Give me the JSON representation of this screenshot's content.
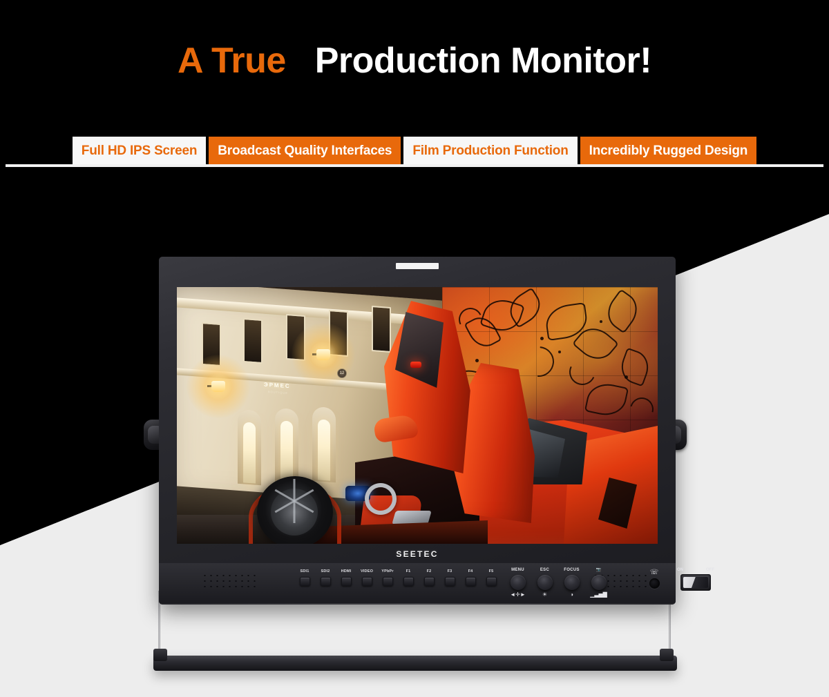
{
  "headline": {
    "accent_text": "A True",
    "plain_text": "Production Monitor!"
  },
  "feature_tabs": [
    {
      "label": "Full HD IPS Screen",
      "style": "light"
    },
    {
      "label": "Broadcast Quality Interfaces",
      "style": "solid"
    },
    {
      "label": "Film Production Function",
      "style": "light"
    },
    {
      "label": "Incredibly Rugged Design",
      "style": "solid"
    }
  ],
  "monitor": {
    "brand": "SEETEC",
    "sensor_strip": "",
    "input_buttons": [
      "SDI1",
      "SDI2",
      "HDMI",
      "VIDEO",
      "YPbPr",
      "F1",
      "F2",
      "F3",
      "F4",
      "F5"
    ],
    "knobs": [
      {
        "label": "MENU",
        "glyph": "◄✛►"
      },
      {
        "label": "ESC",
        "glyph": "☀"
      },
      {
        "label": "FOCUS",
        "glyph": "◑"
      },
      {
        "label": "📷",
        "glyph": "▁▃▅▇"
      }
    ],
    "headphone_jack": {
      "icon": "☏",
      "label": "headphone-jack"
    },
    "power_switch": {
      "on_label": "ON",
      "off_label": "OFF"
    }
  },
  "screen_image": {
    "description": "Orange Lamborghini Aventador with scissor door open at night",
    "building_sign": "ЭРМЕС",
    "building_sign_sub": "BOUTIQUE",
    "house_number": "12"
  },
  "colors": {
    "brand_orange": "#E8690B",
    "background_black": "#000000",
    "background_light": "#EDEDED",
    "tab_light_bg": "#F7F7F7",
    "chassis": "#2A2A30",
    "car_red": "#E8390F"
  }
}
